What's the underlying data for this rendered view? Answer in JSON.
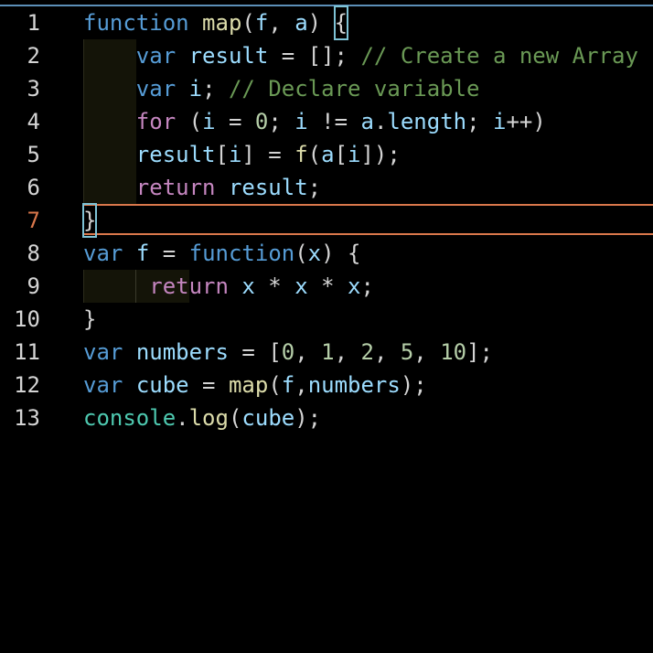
{
  "editor": {
    "language": "javascript",
    "active_line": 7,
    "colors": {
      "keyword": "#569cd6",
      "function": "#dcdcaa",
      "variable": "#9cdcfe",
      "comment": "#6a9955",
      "control": "#c586c0",
      "number": "#b5cea8",
      "object": "#4ec9b0",
      "punctuation": "#d4d4d4",
      "active_line_border": "#d9774b",
      "bracket_match": "#7ec3d6"
    },
    "line_numbers": [
      "1",
      "2",
      "3",
      "4",
      "5",
      "6",
      "7",
      "8",
      "9",
      "10",
      "11",
      "12",
      "13"
    ],
    "lines": [
      [
        {
          "t": "function",
          "c": "kw"
        },
        {
          "t": " ",
          "c": "punc"
        },
        {
          "t": "map",
          "c": "fn"
        },
        {
          "t": "(",
          "c": "punc"
        },
        {
          "t": "f",
          "c": "var"
        },
        {
          "t": ", ",
          "c": "punc"
        },
        {
          "t": "a",
          "c": "var"
        },
        {
          "t": ") ",
          "c": "punc"
        },
        {
          "t": "{",
          "c": "punc",
          "box": true
        }
      ],
      [
        {
          "t": "    ",
          "c": "punc"
        },
        {
          "t": "var",
          "c": "kw"
        },
        {
          "t": " ",
          "c": "punc"
        },
        {
          "t": "result",
          "c": "var"
        },
        {
          "t": " = []; ",
          "c": "punc"
        },
        {
          "t": "// Create a new Array",
          "c": "cm"
        }
      ],
      [
        {
          "t": "    ",
          "c": "punc"
        },
        {
          "t": "var",
          "c": "kw"
        },
        {
          "t": " ",
          "c": "punc"
        },
        {
          "t": "i",
          "c": "var"
        },
        {
          "t": "; ",
          "c": "punc"
        },
        {
          "t": "// Declare variable",
          "c": "cm"
        }
      ],
      [
        {
          "t": "    ",
          "c": "punc"
        },
        {
          "t": "for",
          "c": "ctrl"
        },
        {
          "t": " (",
          "c": "punc"
        },
        {
          "t": "i",
          "c": "var"
        },
        {
          "t": " = ",
          "c": "punc"
        },
        {
          "t": "0",
          "c": "num"
        },
        {
          "t": "; ",
          "c": "punc"
        },
        {
          "t": "i",
          "c": "var"
        },
        {
          "t": " != ",
          "c": "punc"
        },
        {
          "t": "a",
          "c": "var"
        },
        {
          "t": ".",
          "c": "punc"
        },
        {
          "t": "length",
          "c": "var"
        },
        {
          "t": "; ",
          "c": "punc"
        },
        {
          "t": "i",
          "c": "var"
        },
        {
          "t": "++)",
          "c": "punc"
        }
      ],
      [
        {
          "t": "    ",
          "c": "punc"
        },
        {
          "t": "result",
          "c": "var"
        },
        {
          "t": "[",
          "c": "punc"
        },
        {
          "t": "i",
          "c": "var"
        },
        {
          "t": "] = ",
          "c": "punc"
        },
        {
          "t": "f",
          "c": "fn"
        },
        {
          "t": "(",
          "c": "punc"
        },
        {
          "t": "a",
          "c": "var"
        },
        {
          "t": "[",
          "c": "punc"
        },
        {
          "t": "i",
          "c": "var"
        },
        {
          "t": "]);",
          "c": "punc"
        }
      ],
      [
        {
          "t": "    ",
          "c": "punc"
        },
        {
          "t": "return",
          "c": "ctrl"
        },
        {
          "t": " ",
          "c": "punc"
        },
        {
          "t": "result",
          "c": "var"
        },
        {
          "t": ";",
          "c": "punc"
        }
      ],
      [
        {
          "t": "}",
          "c": "punc",
          "box": true
        }
      ],
      [
        {
          "t": "var",
          "c": "kw"
        },
        {
          "t": " ",
          "c": "punc"
        },
        {
          "t": "f",
          "c": "var"
        },
        {
          "t": " = ",
          "c": "punc"
        },
        {
          "t": "function",
          "c": "kw"
        },
        {
          "t": "(",
          "c": "punc"
        },
        {
          "t": "x",
          "c": "var"
        },
        {
          "t": ") {",
          "c": "punc"
        }
      ],
      [
        {
          "t": "     ",
          "c": "punc"
        },
        {
          "t": "return",
          "c": "ctrl"
        },
        {
          "t": " ",
          "c": "punc"
        },
        {
          "t": "x",
          "c": "var"
        },
        {
          "t": " * ",
          "c": "punc"
        },
        {
          "t": "x",
          "c": "var"
        },
        {
          "t": " * ",
          "c": "punc"
        },
        {
          "t": "x",
          "c": "var"
        },
        {
          "t": ";",
          "c": "punc"
        }
      ],
      [
        {
          "t": "}",
          "c": "punc"
        }
      ],
      [
        {
          "t": "var",
          "c": "kw"
        },
        {
          "t": " ",
          "c": "punc"
        },
        {
          "t": "numbers",
          "c": "var"
        },
        {
          "t": " = [",
          "c": "punc"
        },
        {
          "t": "0",
          "c": "num"
        },
        {
          "t": ", ",
          "c": "punc"
        },
        {
          "t": "1",
          "c": "num"
        },
        {
          "t": ", ",
          "c": "punc"
        },
        {
          "t": "2",
          "c": "num"
        },
        {
          "t": ", ",
          "c": "punc"
        },
        {
          "t": "5",
          "c": "num"
        },
        {
          "t": ", ",
          "c": "punc"
        },
        {
          "t": "10",
          "c": "num"
        },
        {
          "t": "];",
          "c": "punc"
        }
      ],
      [
        {
          "t": "var",
          "c": "kw"
        },
        {
          "t": " ",
          "c": "punc"
        },
        {
          "t": "cube",
          "c": "var"
        },
        {
          "t": " = ",
          "c": "punc"
        },
        {
          "t": "map",
          "c": "fn"
        },
        {
          "t": "(",
          "c": "punc"
        },
        {
          "t": "f",
          "c": "var"
        },
        {
          "t": ",",
          "c": "punc"
        },
        {
          "t": "numbers",
          "c": "var"
        },
        {
          "t": ");",
          "c": "punc"
        }
      ],
      [
        {
          "t": "console",
          "c": "obj"
        },
        {
          "t": ".",
          "c": "punc"
        },
        {
          "t": "log",
          "c": "fn"
        },
        {
          "t": "(",
          "c": "punc"
        },
        {
          "t": "cube",
          "c": "var"
        },
        {
          "t": ");",
          "c": "punc"
        }
      ]
    ]
  }
}
